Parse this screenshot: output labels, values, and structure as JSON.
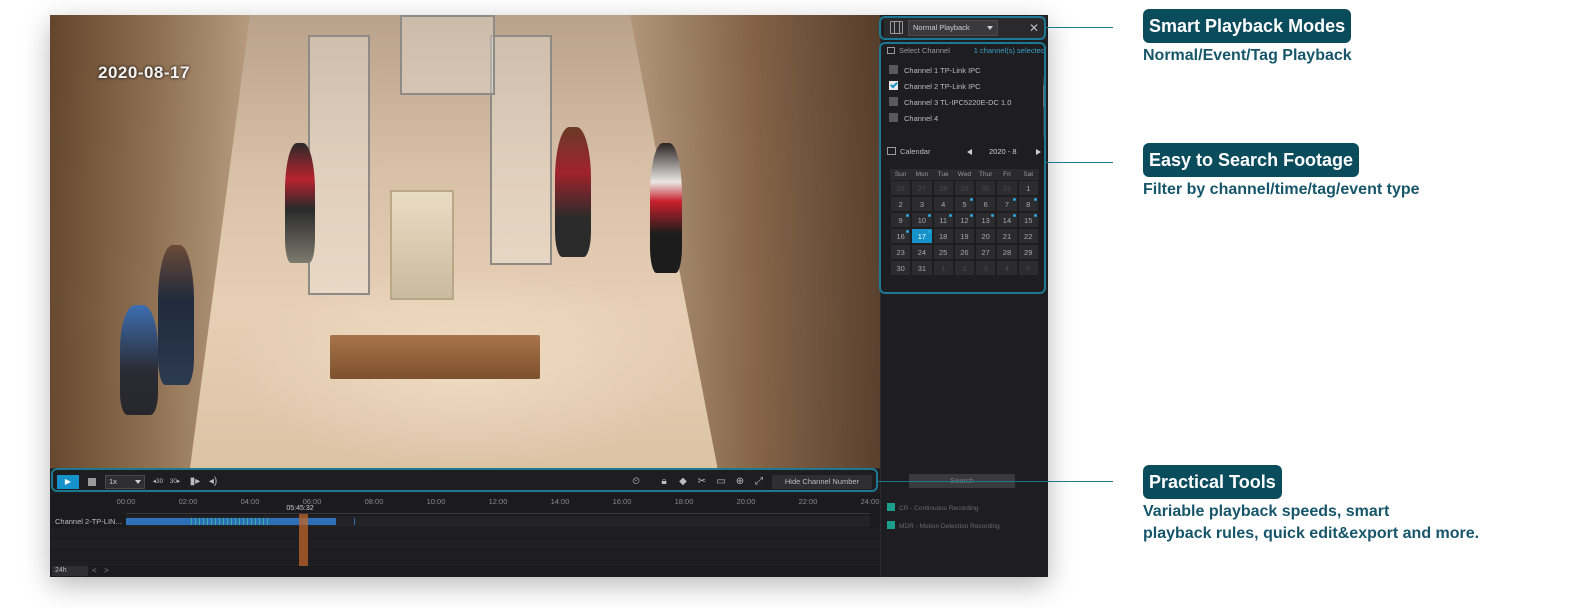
{
  "video": {
    "date_overlay": "2020-08-17"
  },
  "sidebar": {
    "playback_mode": "Normal Playback",
    "close_icon": "close-icon",
    "select_channel_label": "Select Channel",
    "channels_selected": "1 channel(s) selected",
    "channels": [
      {
        "label": "Channel 1 TP-Link IPC",
        "checked": false
      },
      {
        "label": "Channel 2 TP-Link IPC",
        "checked": true
      },
      {
        "label": "Channel 3 TL-IPC5220E-DC 1.0",
        "checked": false
      },
      {
        "label": "Channel 4",
        "checked": false
      }
    ],
    "calendar": {
      "label": "Calendar",
      "month": "2020 - 8",
      "days_of_week": [
        "Sun",
        "Mon",
        "Tue",
        "Wed",
        "Thur",
        "Fri",
        "Sat"
      ],
      "selected_day": "17",
      "weeks": [
        [
          "26",
          "27",
          "28",
          "29",
          "30",
          "31",
          "1"
        ],
        [
          "2",
          "3",
          "4",
          "5",
          "6",
          "7",
          "8"
        ],
        [
          "9",
          "10",
          "11",
          "12",
          "13",
          "14",
          "15"
        ],
        [
          "16",
          "17",
          "18",
          "19",
          "20",
          "21",
          "22"
        ],
        [
          "23",
          "24",
          "25",
          "26",
          "27",
          "28",
          "29"
        ],
        [
          "30",
          "31",
          "1",
          "2",
          "3",
          "4",
          "5"
        ]
      ]
    },
    "search_label": "Search",
    "legend": [
      "CR - Continuous Recording",
      "MDR - Motion Detection Recording"
    ]
  },
  "toolbar": {
    "speed": "1x",
    "back30": "◂30",
    "fwd30": "30▸",
    "hide_channel_number": "Hide Channel Number"
  },
  "timeline": {
    "ticks": [
      "00:00",
      "02:00",
      "04:00",
      "06:00",
      "08:00",
      "10:00",
      "12:00",
      "14:00",
      "16:00",
      "18:00",
      "20:00",
      "22:00",
      "24:00"
    ],
    "cursor_time": "05:45:32",
    "track_label": "Channel 2-TP-LIN...",
    "range": "24h",
    "nav_prev": "<",
    "nav_next": ">"
  },
  "callouts": [
    {
      "title": "Smart Playback Modes",
      "subtitle": [
        "Normal/Event/Tag Playback"
      ]
    },
    {
      "title": "Easy to Search Footage",
      "subtitle": [
        "Filter by channel/time/tag/event type"
      ]
    },
    {
      "title": "Practical Tools",
      "subtitle": [
        "Variable playback speeds, smart",
        "playback rules, quick edit&export and more."
      ]
    }
  ],
  "colors": {
    "accent": "#1592c9",
    "callout_bg": "#0b4c5c",
    "callout_text": "#17566a",
    "outline": "#1d7891"
  }
}
